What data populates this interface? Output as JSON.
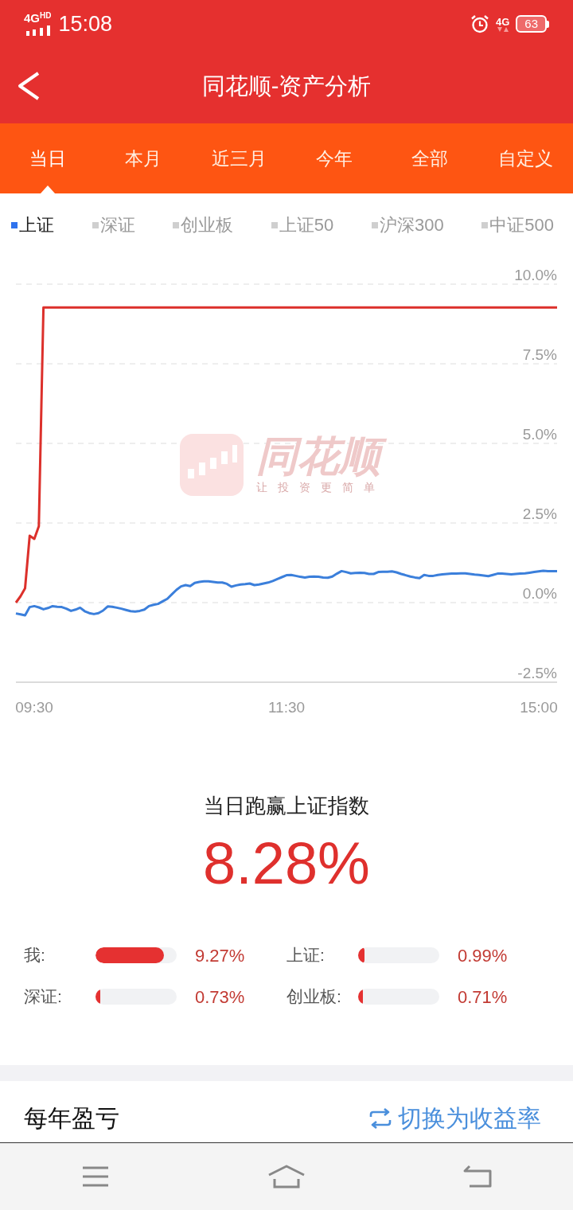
{
  "status_bar": {
    "network_label": "4G",
    "network_badge": "HD",
    "time": "15:08",
    "data_label": "4G",
    "battery": "63"
  },
  "header": {
    "title": "同花顺-资产分析"
  },
  "period_tabs": [
    {
      "label": "当日",
      "selected": true
    },
    {
      "label": "本月",
      "selected": false
    },
    {
      "label": "近三月",
      "selected": false
    },
    {
      "label": "今年",
      "selected": false
    },
    {
      "label": "全部",
      "selected": false
    },
    {
      "label": "自定义",
      "selected": false
    }
  ],
  "chart_legend": [
    {
      "label": "上证",
      "selected": true
    },
    {
      "label": "深证",
      "selected": false
    },
    {
      "label": "创业板",
      "selected": false
    },
    {
      "label": "上证50",
      "selected": false
    },
    {
      "label": "沪深300",
      "selected": false
    },
    {
      "label": "中证500",
      "selected": false
    }
  ],
  "chart": {
    "watermark": {
      "brand": "同花顺",
      "slogan": "让投资更简单"
    },
    "chart_data": {
      "type": "line",
      "grid": true,
      "categories": [
        null,
        null,
        null,
        null,
        "09:30",
        null,
        null,
        null,
        null,
        null,
        null,
        null,
        null,
        null,
        null,
        null,
        null,
        null,
        null,
        null,
        null,
        null,
        null,
        null,
        null,
        null,
        null,
        null,
        null,
        null,
        null,
        null,
        null,
        null,
        null,
        null,
        null,
        null,
        null,
        null,
        null,
        null,
        null,
        null,
        null,
        null,
        null,
        null,
        null,
        null,
        null,
        null,
        null,
        null,
        null,
        null,
        null,
        null,
        null,
        "11:30",
        null,
        null,
        null,
        null,
        null,
        null,
        null,
        null,
        null,
        null,
        null,
        null,
        null,
        null,
        null,
        null,
        null,
        null,
        null,
        null,
        null,
        null,
        null,
        null,
        null,
        null,
        null,
        null,
        null,
        null,
        null,
        null,
        null,
        null,
        null,
        null,
        null,
        null,
        null,
        null,
        null,
        null,
        null,
        null,
        null,
        null,
        null,
        null,
        null,
        null,
        null,
        null,
        null,
        null,
        "15:00",
        null,
        null,
        null,
        null
      ],
      "ylim": [
        -2.5,
        10
      ],
      "yticks": [
        {
          "value": -2.5,
          "label": "-2.5%"
        },
        {
          "value": 0,
          "label": "0.0%"
        },
        {
          "value": 2.5,
          "label": "2.5%"
        },
        {
          "value": 5,
          "label": "5.0%"
        },
        {
          "value": 7.5,
          "label": "7.5%"
        },
        {
          "value": 10,
          "label": "10.0%"
        }
      ],
      "series": [
        {
          "color": "#dc302b",
          "values": [
            0,
            0.2,
            0.45,
            2.1,
            2.0,
            2.4,
            9.27,
            9.27,
            9.27,
            9.27,
            9.27,
            9.27,
            9.27,
            9.27,
            9.27,
            9.27,
            9.27,
            9.27,
            9.27,
            9.27,
            9.27,
            9.27,
            9.27,
            9.27,
            9.27,
            9.27,
            9.27,
            9.27,
            9.27,
            9.27,
            9.27,
            9.27,
            9.27,
            9.27,
            9.27,
            9.27,
            9.27,
            9.27,
            9.27,
            9.27,
            9.27,
            9.27,
            9.27,
            9.27,
            9.27,
            9.27,
            9.27,
            9.27,
            9.27,
            9.27,
            9.27,
            9.27,
            9.27,
            9.27,
            9.27,
            9.27,
            9.27,
            9.27,
            9.27,
            9.27,
            9.27,
            9.27,
            9.27,
            9.27,
            9.27,
            9.27,
            9.27,
            9.27,
            9.27,
            9.27,
            9.27,
            9.27,
            9.27,
            9.27,
            9.27,
            9.27,
            9.27,
            9.27,
            9.27,
            9.27,
            9.27,
            9.27,
            9.27,
            9.27,
            9.27,
            9.27,
            9.27,
            9.27,
            9.27,
            9.27,
            9.27,
            9.27,
            9.27,
            9.27,
            9.27,
            9.27,
            9.27,
            9.27,
            9.27,
            9.27,
            9.27,
            9.27,
            9.27,
            9.27,
            9.27,
            9.27,
            9.27,
            9.27,
            9.27,
            9.27,
            9.27,
            9.27,
            9.27,
            9.27,
            9.27,
            9.27,
            9.27,
            9.27,
            9.27
          ]
        },
        {
          "color": "#3b7fdb",
          "values": [
            -0.34,
            -0.37,
            -0.4,
            -0.14,
            -0.11,
            -0.15,
            -0.21,
            -0.17,
            -0.11,
            -0.13,
            -0.14,
            -0.19,
            -0.26,
            -0.22,
            -0.16,
            -0.27,
            -0.33,
            -0.36,
            -0.33,
            -0.25,
            -0.12,
            -0.13,
            -0.16,
            -0.19,
            -0.23,
            -0.27,
            -0.28,
            -0.26,
            -0.22,
            -0.11,
            -0.07,
            -0.04,
            0.04,
            0.12,
            0.26,
            0.4,
            0.51,
            0.55,
            0.52,
            0.62,
            0.65,
            0.67,
            0.67,
            0.65,
            0.63,
            0.63,
            0.59,
            0.5,
            0.54,
            0.57,
            0.58,
            0.6,
            0.55,
            0.57,
            0.6,
            0.63,
            0.68,
            0.74,
            0.8,
            0.86,
            0.87,
            0.84,
            0.81,
            0.79,
            0.81,
            0.82,
            0.81,
            0.79,
            0.78,
            0.82,
            0.91,
            0.99,
            0.96,
            0.92,
            0.93,
            0.94,
            0.93,
            0.9,
            0.9,
            0.96,
            0.97,
            0.97,
            0.98,
            0.95,
            0.9,
            0.86,
            0.82,
            0.79,
            0.77,
            0.87,
            0.84,
            0.84,
            0.87,
            0.89,
            0.9,
            0.91,
            0.91,
            0.92,
            0.92,
            0.9,
            0.88,
            0.87,
            0.85,
            0.83,
            0.87,
            0.91,
            0.91,
            0.9,
            0.89,
            0.9,
            0.91,
            0.92,
            0.94,
            0.96,
            0.98,
            1.0,
            0.99,
            0.99,
            0.99
          ]
        }
      ]
    }
  },
  "summary": {
    "title": "当日跑赢上证指数",
    "value": "8.28%"
  },
  "comparisons": [
    {
      "label": "我:",
      "level": 0.84,
      "value": "9.27%"
    },
    {
      "label": "上证:",
      "level": 0.08,
      "value": "0.99%"
    },
    {
      "label": "深证:",
      "level": 0.06,
      "value": "0.73%"
    },
    {
      "label": "创业板:",
      "level": 0.06,
      "value": "0.71%"
    }
  ],
  "yearly_section": {
    "title": "每年盈亏",
    "toggle": "切换为收益率"
  }
}
